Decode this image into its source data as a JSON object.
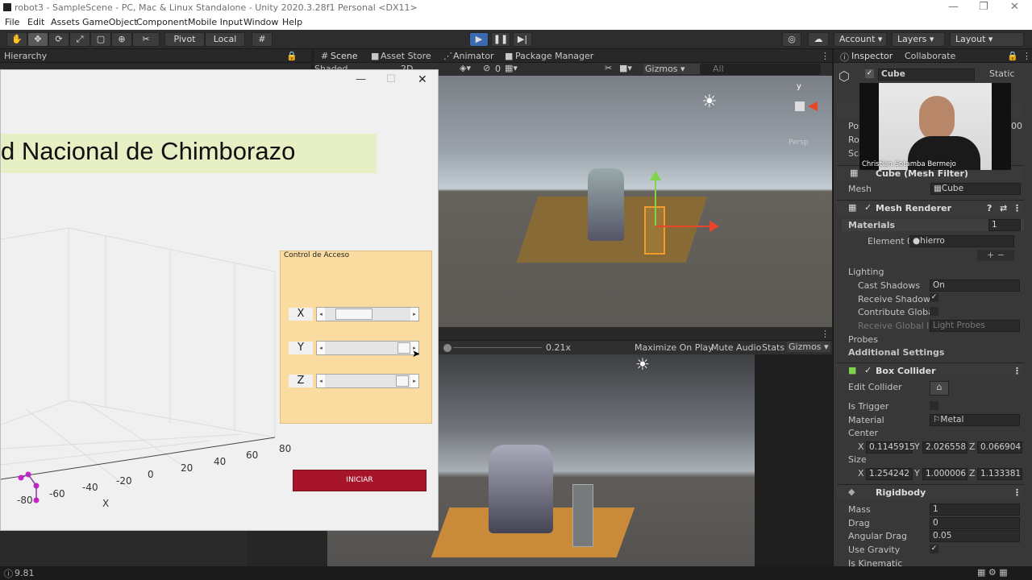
{
  "window": {
    "title": "robot3 - SampleScene - PC, Mac & Linux Standalone - Unity 2020.3.28f1 Personal <DX11>"
  },
  "menu": [
    "File",
    "Edit",
    "Assets",
    "GameObject",
    "Component",
    "Mobile Input",
    "Window",
    "Help"
  ],
  "toolbar": {
    "pivot": "Pivot",
    "local": "Local",
    "account": "Account",
    "layers": "Layers",
    "layout": "Layout"
  },
  "hierarchy": {
    "tab": "Hierarchy",
    "search": "All"
  },
  "scene_tabs": [
    "Scene",
    "Asset Store",
    "Animator",
    "Package Manager"
  ],
  "scene_bar": {
    "shading": "Shaded",
    "mode_2d": "2D",
    "gizmos": "Gizmos",
    "search": "All",
    "hidden_count": "0"
  },
  "scene_gizmo": {
    "y": "y",
    "persp": "Persp"
  },
  "game_bar": {
    "scale": "0.21x",
    "maximize": "Maximize On Play",
    "mute": "Mute Audio",
    "stats": "Stats",
    "gizmos": "Gizmos"
  },
  "status": {
    "value": "9.81"
  },
  "inspector": {
    "tabs": [
      "Inspector",
      "Collaborate"
    ],
    "object_name": "Cube",
    "static": "Static",
    "transform_rows": [
      "Pos",
      "Rot",
      "Sca"
    ],
    "pos_clip": "00",
    "mesh_filter": "Cube (Mesh Filter)",
    "mesh_label": "Mesh",
    "mesh_value": "Cube",
    "mesh_renderer": "Mesh Renderer",
    "materials": "Materials",
    "materials_count": "1",
    "element0": "Element 0",
    "element0_value": "hierro",
    "lighting": "Lighting",
    "lighting_rows": [
      {
        "label": "Cast Shadows",
        "value": "On"
      },
      {
        "label": "Receive Shadows",
        "value": "✓"
      },
      {
        "label": "Contribute Global",
        "value": ""
      },
      {
        "label": "Receive Global Illu",
        "value": "Light Probes"
      }
    ],
    "probes": "Probes",
    "additional": "Additional Settings",
    "box_collider": "Box Collider",
    "edit_collider": "Edit Collider",
    "is_trigger": "Is Trigger",
    "material": "Material",
    "material_value": "Metal",
    "center": "Center",
    "center_x": "0.1145915",
    "center_y": "2.026558",
    "center_z": "0.066904",
    "size": "Size",
    "size_x": "1.254242",
    "size_y": "1.000006",
    "size_z": "1.133381",
    "rigidbody": "Rigidbody",
    "rb_rows": [
      {
        "label": "Mass",
        "value": "1"
      },
      {
        "label": "Drag",
        "value": "0"
      },
      {
        "label": "Angular Drag",
        "value": "0.05"
      },
      {
        "label": "Use Gravity",
        "value": "✓"
      },
      {
        "label": "Is Kinematic",
        "value": ""
      }
    ],
    "axis_labels": {
      "x": "X",
      "y": "Y",
      "z": "Z"
    }
  },
  "webcam": {
    "name": "Christian Sotamba Bermejo"
  },
  "matlab": {
    "banner": "d Nacional de Chimborazo",
    "panel_title": "Control de Acceso",
    "slider_labels": [
      "X",
      "Y",
      "Z"
    ],
    "sliders": [
      0.22,
      1.0,
      0.98
    ],
    "button": "INICIAR",
    "ticks_x": [
      "-80",
      "-60",
      "-40",
      "-20",
      "0",
      "20",
      "40",
      "60",
      "80"
    ],
    "xlabel": "X"
  }
}
